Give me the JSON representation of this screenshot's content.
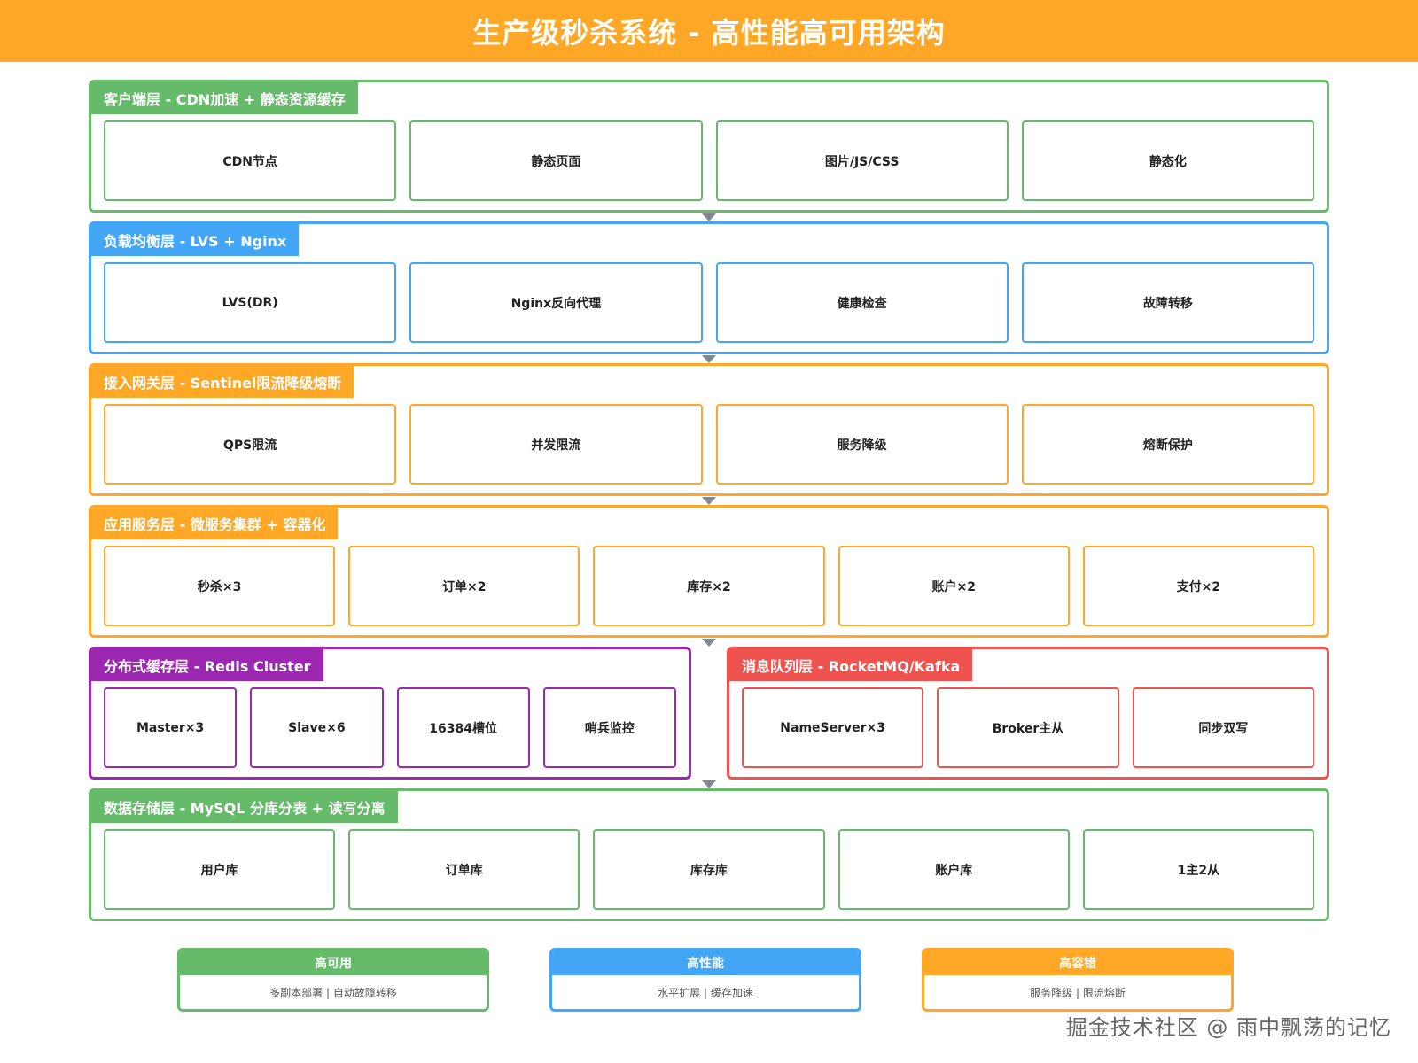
{
  "title": "生产级秒杀系统 - 高性能高可用架构",
  "colors": {
    "header": "#FFA726",
    "green": "#66BB6A",
    "blue": "#42A5F5",
    "orange": "#FFA726",
    "purple": "#9C27B0",
    "red": "#EF5350"
  },
  "layers": {
    "client": {
      "label": "客户端层 - CDN加速 + 静态资源缓存",
      "items": [
        "CDN节点",
        "静态页面",
        "图片/JS/CSS",
        "静态化"
      ]
    },
    "lb": {
      "label": "负载均衡层 - LVS + Nginx",
      "items": [
        "LVS(DR)",
        "Nginx反向代理",
        "健康检查",
        "故障转移"
      ]
    },
    "gateway": {
      "label": "接入网关层 - Sentinel限流降级熔断",
      "items": [
        "QPS限流",
        "并发限流",
        "服务降级",
        "熔断保护"
      ]
    },
    "app": {
      "label": "应用服务层 - 微服务集群 + 容器化",
      "items": [
        "秒杀×3",
        "订单×2",
        "库存×2",
        "账户×2",
        "支付×2"
      ]
    },
    "cache": {
      "label": "分布式缓存层 - Redis Cluster",
      "items": [
        "Master×3",
        "Slave×6",
        "16384槽位",
        "哨兵监控"
      ]
    },
    "mq": {
      "label": "消息队列层 - RocketMQ/Kafka",
      "items": [
        "NameServer×3",
        "Broker主从",
        "同步双写"
      ]
    },
    "db": {
      "label": "数据存储层 - MySQL 分库分表 + 读写分离",
      "items": [
        "用户库",
        "订单库",
        "库存库",
        "账户库",
        "1主2从"
      ]
    }
  },
  "legend": [
    {
      "title": "高可用",
      "desc": "多副本部署 | 自动故障转移"
    },
    {
      "title": "高性能",
      "desc": "水平扩展 | 缓存加速"
    },
    {
      "title": "高容错",
      "desc": "服务降级 | 限流熔断"
    }
  ],
  "watermark": "掘金技术社区 @ 雨中飘荡的记忆"
}
